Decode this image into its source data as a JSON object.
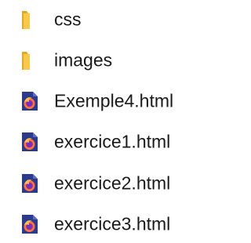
{
  "files": [
    {
      "name": "css",
      "icon": "folder-icon"
    },
    {
      "name": "images",
      "icon": "folder-icon"
    },
    {
      "name": "Exemple4.html",
      "icon": "firefox-html-file-icon"
    },
    {
      "name": "exercice1.html",
      "icon": "firefox-html-file-icon"
    },
    {
      "name": "exercice2.html",
      "icon": "firefox-html-file-icon"
    },
    {
      "name": "exercice3.html",
      "icon": "firefox-html-file-icon"
    }
  ],
  "colors": {
    "folder": "#f8c84a",
    "folder_dark": "#e0a92a",
    "page": "#2b3a8c",
    "firefox_orange": "#ff7139",
    "firefox_yellow": "#ffbd4f",
    "firefox_purple": "#7b2fbf",
    "text": "#1a1a1a"
  }
}
